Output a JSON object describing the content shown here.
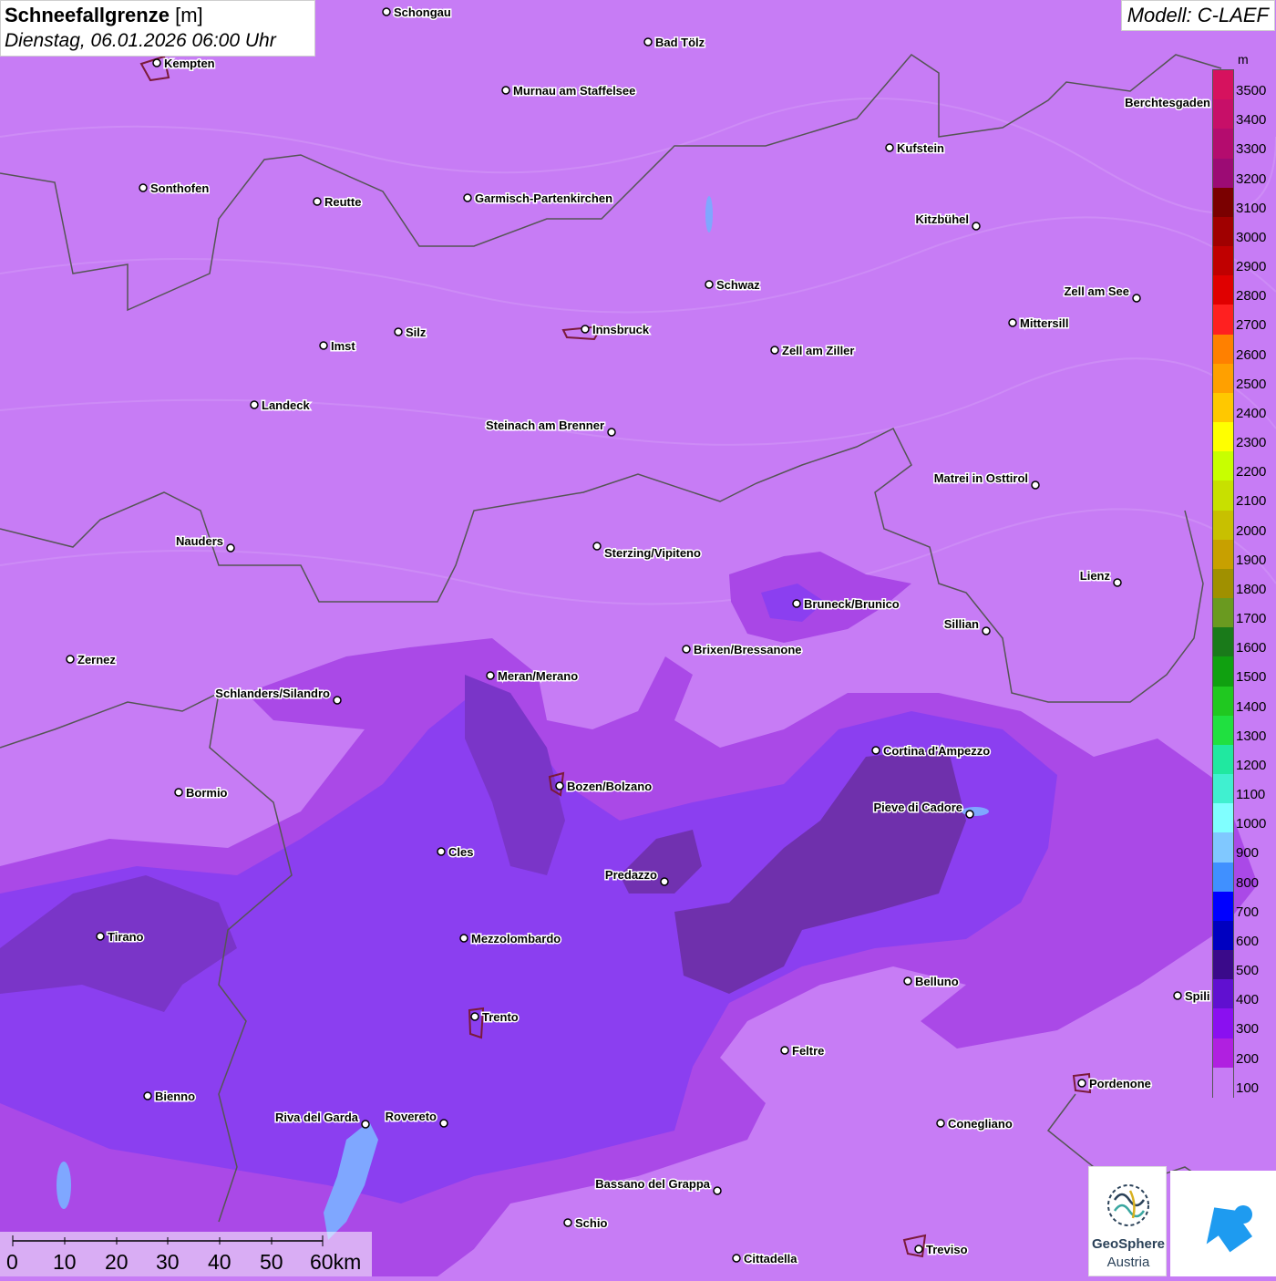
{
  "header": {
    "title": "Schneefallgrenze",
    "unit": "[m]",
    "datetime": "Dienstag, 06.01.2026 06:00 Uhr",
    "model": "Modell: C-LAEF"
  },
  "legend": {
    "unit": "m",
    "labels": [
      "3500",
      "3400",
      "3300",
      "3200",
      "3100",
      "3000",
      "2900",
      "2800",
      "2700",
      "2600",
      "2500",
      "2400",
      "2300",
      "2200",
      "2100",
      "2000",
      "1900",
      "1800",
      "1700",
      "1600",
      "1500",
      "1400",
      "1300",
      "1200",
      "1100",
      "1000",
      "900",
      "800",
      "700",
      "600",
      "500",
      "400",
      "300",
      "200",
      "100"
    ],
    "colors": [
      "#d6125e",
      "#c70f68",
      "#b40c6e",
      "#9c0b74",
      "#7a0000",
      "#a00000",
      "#c00000",
      "#e00000",
      "#ff2020",
      "#ff8000",
      "#ffa000",
      "#ffc800",
      "#ffff00",
      "#c8ff00",
      "#c8e000",
      "#c8c000",
      "#c8a000",
      "#a09000",
      "#6a9a20",
      "#1a7a1a",
      "#10a010",
      "#20c820",
      "#20e040",
      "#20e8a0",
      "#40f0d0",
      "#80ffff",
      "#80c8ff",
      "#4090ff",
      "#0000ff",
      "#0000c0",
      "#3a0a8a",
      "#6010d0",
      "#8a10f0",
      "#b020e0",
      "#c77cf5"
    ]
  },
  "map": {
    "colors": {
      "level_100": "#c77cf5",
      "level_200": "#a947e6",
      "level_300": "#8b3ff0",
      "level_400": "#7a35c8",
      "level_500": "#6a2ea0",
      "border": "#555555",
      "lake": "#7fa7ff",
      "city_outline": "#7a1a3a"
    },
    "cities": [
      {
        "name": "Schongau"
      },
      {
        "name": "Bad Tölz"
      },
      {
        "name": "Kempten"
      },
      {
        "name": "Murnau am Staffelsee"
      },
      {
        "name": "Berchtesgaden"
      },
      {
        "name": "Kufstein"
      },
      {
        "name": "Sonthofen"
      },
      {
        "name": "Reutte"
      },
      {
        "name": "Garmisch-Partenkirchen"
      },
      {
        "name": "Kitzbühel"
      },
      {
        "name": "Schwaz"
      },
      {
        "name": "Zell am See"
      },
      {
        "name": "Mittersill"
      },
      {
        "name": "Innsbruck"
      },
      {
        "name": "Silz"
      },
      {
        "name": "Imst"
      },
      {
        "name": "Zell am Ziller"
      },
      {
        "name": "Landeck"
      },
      {
        "name": "Steinach am Brenner"
      },
      {
        "name": "Matrei in Osttirol"
      },
      {
        "name": "Nauders"
      },
      {
        "name": "Sterzing/Vipiteno"
      },
      {
        "name": "Lienz"
      },
      {
        "name": "Bruneck/Brunico"
      },
      {
        "name": "Sillian"
      },
      {
        "name": "Brixen/Bressanone"
      },
      {
        "name": "Zernez"
      },
      {
        "name": "Meran/Merano"
      },
      {
        "name": "Schlanders/Silandro"
      },
      {
        "name": "Cortina d'Ampezzo"
      },
      {
        "name": "Bozen/Bolzano"
      },
      {
        "name": "Bormio"
      },
      {
        "name": "Pieve di Cadore"
      },
      {
        "name": "Cles"
      },
      {
        "name": "Predazzo"
      },
      {
        "name": "Tirano"
      },
      {
        "name": "Mezzolombardo"
      },
      {
        "name": "Belluno"
      },
      {
        "name": "Spili"
      },
      {
        "name": "Trento"
      },
      {
        "name": "Feltre"
      },
      {
        "name": "Pordenone"
      },
      {
        "name": "Bienno"
      },
      {
        "name": "Riva del Garda"
      },
      {
        "name": "Rovereto"
      },
      {
        "name": "Conegliano"
      },
      {
        "name": "Bassano del Grappa"
      },
      {
        "name": "Schio"
      },
      {
        "name": "Treviso"
      },
      {
        "name": "Cittadella"
      }
    ]
  },
  "scale_bar": {
    "labels": [
      "0",
      "10",
      "20",
      "30",
      "40",
      "50",
      "60km"
    ]
  },
  "logos": {
    "geosphere_line1": "GeoSphere",
    "geosphere_line2": "Austria"
  }
}
